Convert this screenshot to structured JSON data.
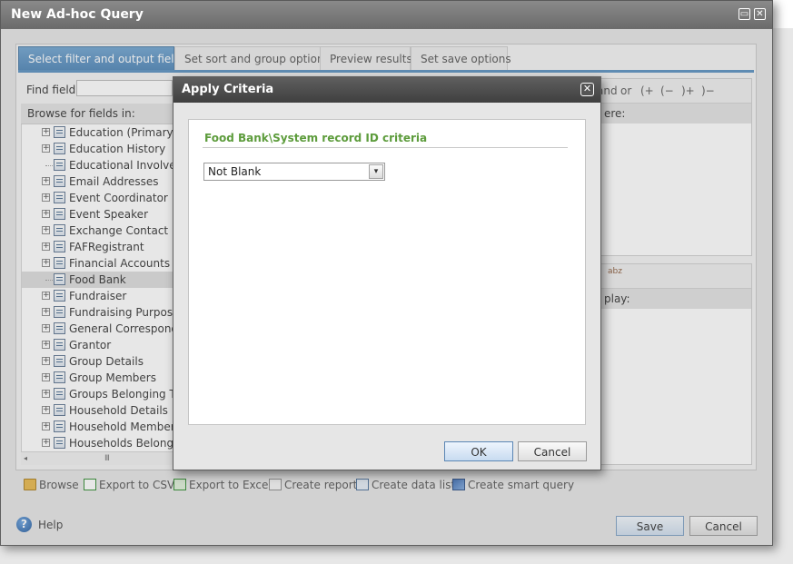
{
  "window": {
    "title": "New Ad-hoc Query",
    "maximize_glyph": "▭",
    "close_glyph": "✕"
  },
  "tabs": [
    {
      "label": "Select filter and output fields",
      "active": true
    },
    {
      "label": "Set sort and group options",
      "active": false
    },
    {
      "label": "Preview results",
      "active": false
    },
    {
      "label": "Set save options",
      "active": false
    }
  ],
  "left_panel": {
    "find_label": "Find field:",
    "find_value": "",
    "browse_label": "Browse for fields in:",
    "tree_items": [
      {
        "label": "Education (Primary)",
        "expandable": true,
        "selected": false
      },
      {
        "label": "Education History",
        "expandable": true,
        "selected": false
      },
      {
        "label": "Educational Involvem",
        "expandable": false,
        "selected": false
      },
      {
        "label": "Email Addresses",
        "expandable": true,
        "selected": false
      },
      {
        "label": "Event Coordinator",
        "expandable": true,
        "selected": false
      },
      {
        "label": "Event Speaker",
        "expandable": true,
        "selected": false
      },
      {
        "label": "Exchange Contact",
        "expandable": true,
        "selected": false
      },
      {
        "label": "FAFRegistrant",
        "expandable": true,
        "selected": false
      },
      {
        "label": "Financial Accounts",
        "expandable": true,
        "selected": false
      },
      {
        "label": "Food Bank",
        "expandable": false,
        "selected": true
      },
      {
        "label": "Fundraiser",
        "expandable": true,
        "selected": false
      },
      {
        "label": "Fundraising Purpose F",
        "expandable": true,
        "selected": false
      },
      {
        "label": "General Corresponder",
        "expandable": true,
        "selected": false
      },
      {
        "label": "Grantor",
        "expandable": true,
        "selected": false
      },
      {
        "label": "Group Details",
        "expandable": true,
        "selected": false
      },
      {
        "label": "Group Members",
        "expandable": true,
        "selected": false
      },
      {
        "label": "Groups Belonging To",
        "expandable": true,
        "selected": false
      },
      {
        "label": "Household Details",
        "expandable": true,
        "selected": false
      },
      {
        "label": "Household Members",
        "expandable": true,
        "selected": false
      },
      {
        "label": "Households Belongin",
        "expandable": true,
        "selected": false
      }
    ],
    "scroll_left_glyph": "◂",
    "scroll_thumb_glyph": "III"
  },
  "right_panel": {
    "operators": [
      "and",
      "or",
      "(+",
      "(−",
      ")+",
      ")−"
    ],
    "filter_header": "ere:",
    "output_tool_label": "abz",
    "output_header": "play:"
  },
  "bottom_toolbar": [
    {
      "label": "Browse",
      "icon": "folder-icon"
    },
    {
      "label": "Export to CSV",
      "icon": "csv-icon"
    },
    {
      "label": "Export to Excel",
      "icon": "excel-icon"
    },
    {
      "label": "Create report",
      "icon": "report-icon"
    },
    {
      "label": "Create data list",
      "icon": "datalist-icon"
    },
    {
      "label": "Create smart query",
      "icon": "smart-query-icon"
    }
  ],
  "footer": {
    "help_glyph": "?",
    "help_label": "Help",
    "save_label": "Save",
    "cancel_label": "Cancel"
  },
  "modal": {
    "title": "Apply Criteria",
    "close_glyph": "✕",
    "criteria_title": "Food Bank\\System record ID criteria",
    "selected_value": "Not Blank",
    "select_arrow_glyph": "▾",
    "ok_label": "OK",
    "cancel_label": "Cancel"
  },
  "colors": {
    "active_tab": "#5a90c0",
    "criteria_title": "#5d9c3c",
    "modal_title_bar": "#4a4a4a"
  }
}
